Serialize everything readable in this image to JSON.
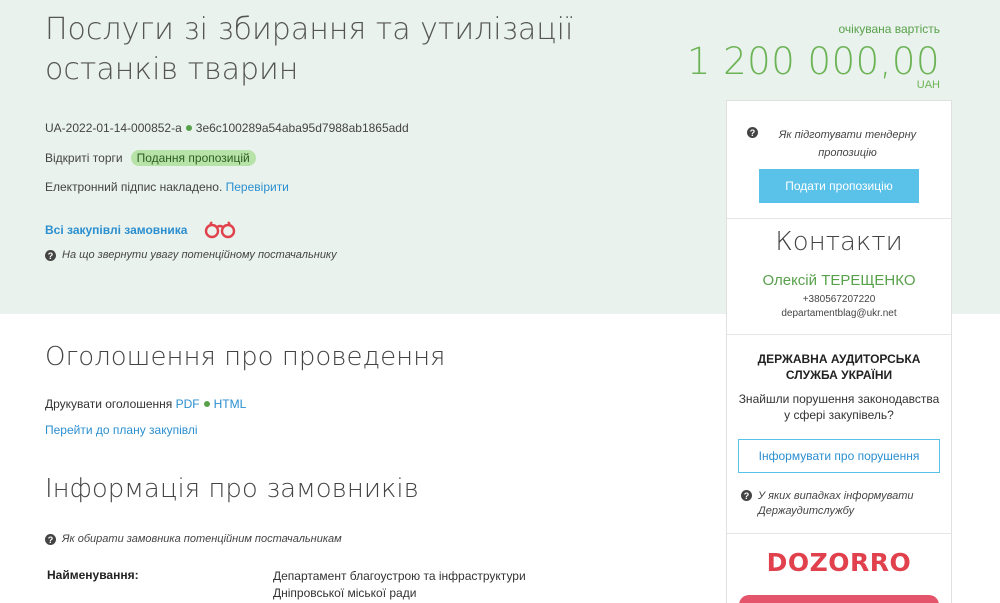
{
  "tender": {
    "title": "Послуги зі збирання та утилізації останків тварин",
    "id": "UA-2022-01-14-000852-a",
    "hash": "3e6c100289a54aba95d7988ab1865add",
    "procedure_type": "Відкриті торги",
    "status_badge": "Подання пропозицій",
    "signature_text": "Електронний підпис накладено.",
    "signature_link": "Перевірити",
    "all_purchases_link": "Всі закупівлі замовника",
    "supplier_hint": "На що звернути увагу потенційному постачальнику"
  },
  "price": {
    "label": "очікувана вартість",
    "amount": "1 200 000,00",
    "currency": "UAH"
  },
  "sidebar": {
    "prepare_hint": "Як підготувати тендерну пропозицію",
    "submit_button": "Подати пропозицію",
    "contacts_title": "Контакти",
    "contact_name": "Олексій ТЕРЕЩЕНКО",
    "contact_phone": "+380567207220",
    "contact_email": "departamentblag@ukr.net",
    "audit_title": "ДЕРЖАВНА АУДИТОРСЬКА СЛУЖБА УКРАЇНИ",
    "audit_text": "Знайшли порушення законодавства у сфері закупівель?",
    "report_button": "Інформувати про порушення",
    "audit_hint": "У яких випадках інформувати Держаудитслужбу",
    "dozorro_logo": "DOZORRO"
  },
  "announcement": {
    "title": "Оголошення про проведення",
    "print_label": "Друкувати оголошення",
    "pdf_link": "PDF",
    "html_link": "HTML",
    "plan_link": "Перейти до плану закупівлі"
  },
  "customers": {
    "title": "Інформація про замовників",
    "hint": "Як обирати замовника потенційним постачальникам",
    "name_label": "Найменування:",
    "name_value": "Департамент благоустрою та інфраструктури Дніпровської міської ради"
  },
  "colors": {
    "hero_bg": "#e9f2ec",
    "price_green": "#6cb356",
    "link_blue": "#2b8fd0",
    "button_blue": "#5ac1e8",
    "dozorro_red": "#e0414d"
  }
}
